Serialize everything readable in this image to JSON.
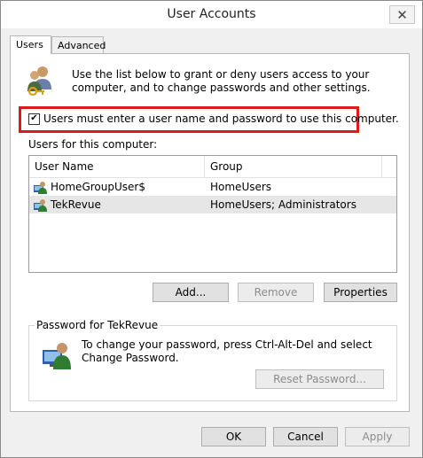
{
  "window": {
    "title": "User Accounts",
    "close_glyph": "✕"
  },
  "tabs": [
    {
      "label": "Users",
      "active": true
    },
    {
      "label": "Advanced",
      "active": false
    }
  ],
  "intro": {
    "text": "Use the list below to grant or deny users access to your computer, and to change passwords and other settings.",
    "icon": "users-keys-icon"
  },
  "require_login": {
    "label": "Users must enter a user name and password to use this computer.",
    "checked": true,
    "highlight_color": "#e0191b"
  },
  "users_list": {
    "label": "Users for this computer:",
    "columns": [
      "User Name",
      "Group"
    ],
    "rows": [
      {
        "name": "HomeGroupUser$",
        "group": "HomeUsers",
        "selected": false,
        "icon": "user-icon"
      },
      {
        "name": "TekRevue",
        "group": "HomeUsers; Administrators",
        "selected": true,
        "icon": "user-icon"
      }
    ]
  },
  "list_buttons": {
    "add": "Add...",
    "remove": "Remove",
    "properties": "Properties"
  },
  "password_group": {
    "legend": "Password for TekRevue",
    "text": "To change your password, press Ctrl-Alt-Del and select Change Password.",
    "reset_button": "Reset Password...",
    "icon": "password-user-icon"
  },
  "footer_buttons": {
    "ok": "OK",
    "cancel": "Cancel",
    "apply": "Apply"
  }
}
